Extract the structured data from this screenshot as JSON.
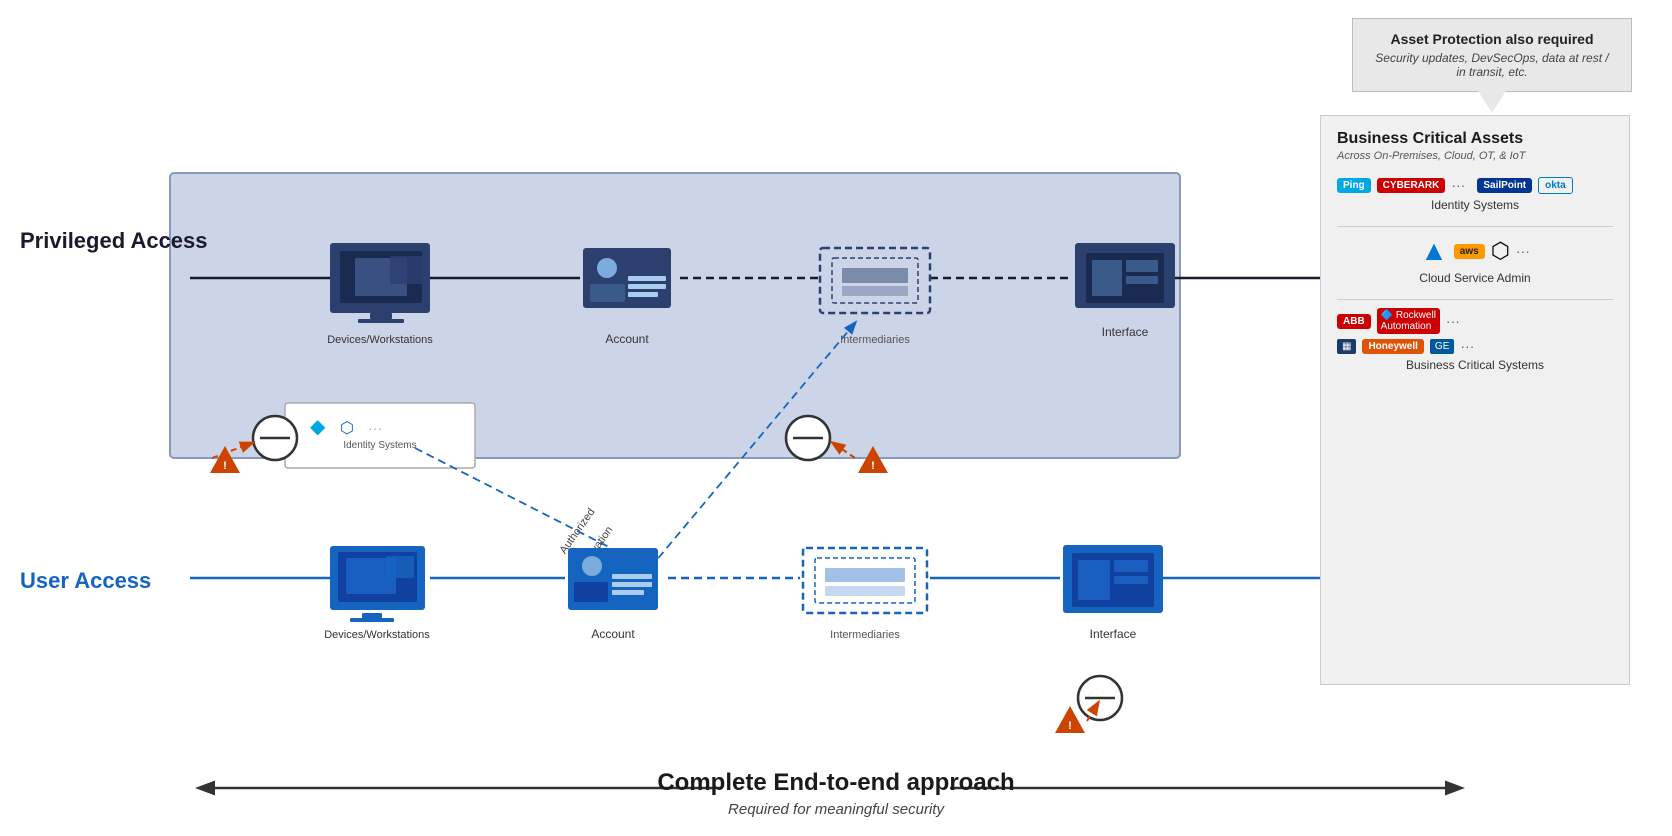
{
  "asset_protection": {
    "title": "Asset Protection also required",
    "subtitle": "Security updates, DevSecOps, data at rest / in transit, etc."
  },
  "privileged_access": {
    "label": "Privileged Access"
  },
  "user_access": {
    "label": "User Access"
  },
  "nodes": {
    "priv_devices": "Devices/Workstations",
    "priv_account": "Account",
    "priv_intermediaries": "Intermediaries",
    "priv_interface": "Interface",
    "identity_systems": "Identity Systems",
    "authorized_elevation": "Authorized\nElevation\nPaths",
    "user_devices": "Devices/Workstations",
    "user_account": "Account",
    "user_intermediaries": "Intermediaries",
    "user_interface": "Interface"
  },
  "bca": {
    "title": "Business Critical Assets",
    "subtitle": "Across On-Premises, Cloud, OT, & IoT",
    "categories": [
      {
        "label": "Identity Systems",
        "logos": [
          "Ping",
          "CYBERARK",
          "SailPoint",
          "okta",
          "..."
        ]
      },
      {
        "label": "Cloud Service Admin",
        "logos": [
          "azure",
          "aws",
          "GCP",
          "..."
        ]
      },
      {
        "label": "Business Critical Systems",
        "logos": [
          "ABB",
          "Rockwell",
          "Honeywell",
          "GE",
          "..."
        ]
      }
    ]
  },
  "bottom": {
    "title": "Complete End-to-end approach",
    "subtitle": "Required for meaningful security"
  }
}
